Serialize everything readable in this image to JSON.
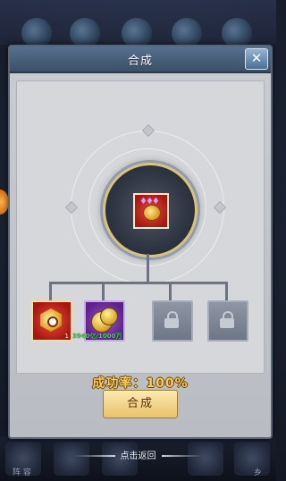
{
  "dialog": {
    "title": "合成",
    "close_symbol": "✕",
    "close_icon": "close-icon"
  },
  "result_item": {
    "icon": "red-treasure-gem-icon"
  },
  "ingredients": [
    {
      "type": "red",
      "icon": "red-gem-medal-icon",
      "requirement": "1"
    },
    {
      "type": "purple",
      "icon": "gold-coins-icon",
      "count_text": "3940亿/1000万"
    },
    {
      "type": "empty",
      "icon": "lock-icon"
    },
    {
      "type": "empty",
      "icon": "lock-icon"
    }
  ],
  "success_rate": "成功率：100%",
  "synth_button": "合成",
  "back_hint": "点击返回",
  "background": {
    "bottom_label_1": "阵 容",
    "bottom_label_2": "乡"
  },
  "colors": {
    "title_bar": "#4a6482",
    "success_text": "#f3cd5d",
    "button": "#f2d68a"
  }
}
